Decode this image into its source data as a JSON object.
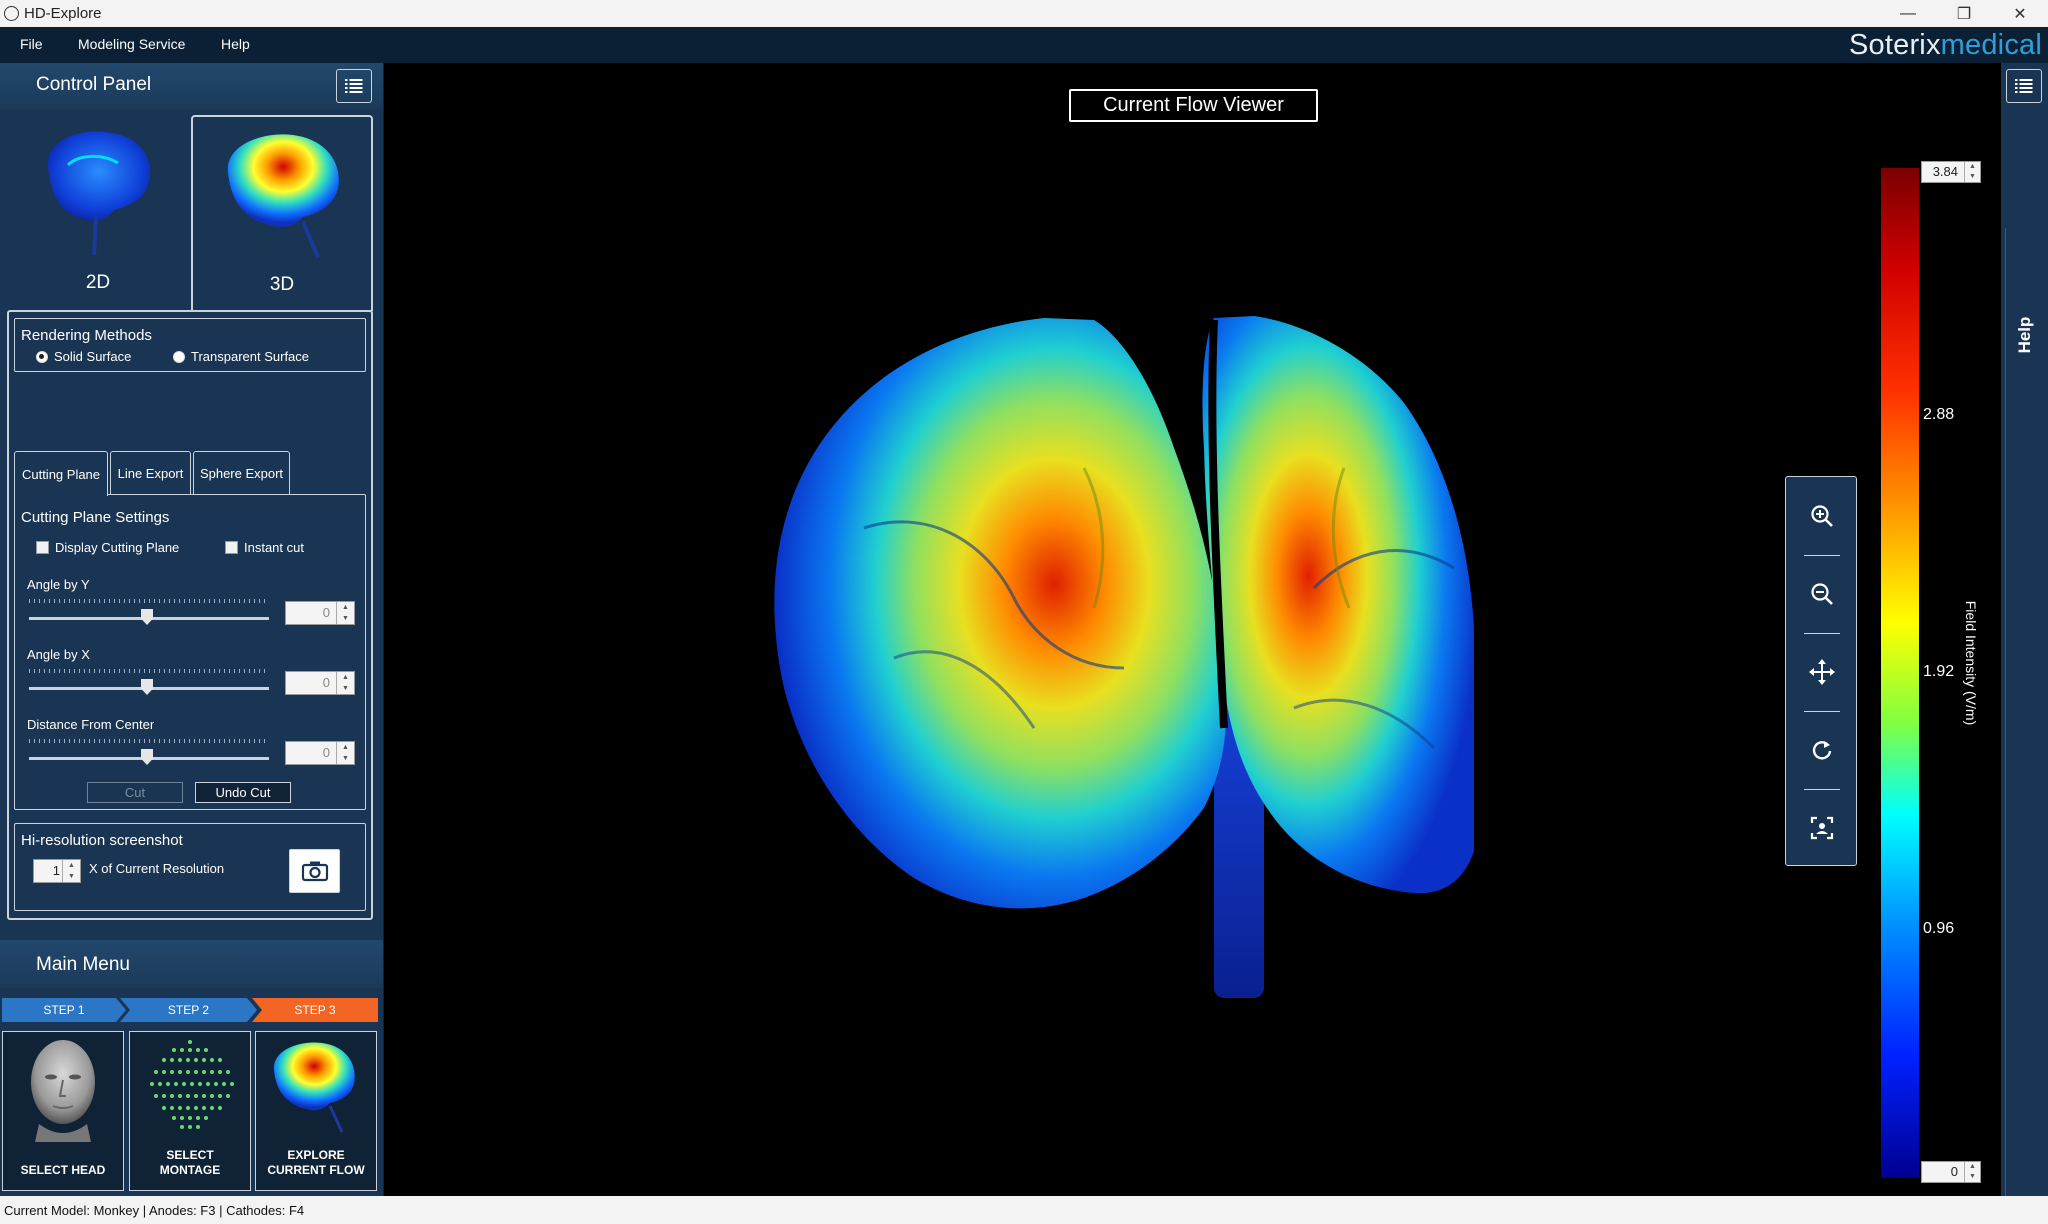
{
  "window": {
    "title": "HD-Explore",
    "minimize": "—",
    "restore": "❐",
    "close": "✕"
  },
  "menu": {
    "file": "File",
    "modeling_service": "Modeling Service",
    "help": "Help",
    "brand_part1": "Soterix",
    "brand_part2": "medical"
  },
  "control_panel": {
    "title": "Control Panel",
    "view_2d": "2D",
    "view_3d": "3D",
    "rendering": {
      "title": "Rendering Methods",
      "solid": "Solid Surface",
      "transparent": "Transparent Surface",
      "selected": "solid"
    },
    "tabs": [
      "Cutting Plane",
      "Line Export",
      "Sphere Export"
    ],
    "active_tab": "Cutting Plane",
    "cutting": {
      "title": "Cutting Plane Settings",
      "display_plane": "Display Cutting Plane",
      "instant_cut": "Instant cut",
      "angle_y_label": "Angle by Y",
      "angle_y_value": "0",
      "angle_x_label": "Angle by X",
      "angle_x_value": "0",
      "distance_label": "Distance From Center",
      "distance_value": "0",
      "cut_label": "Cut",
      "undo_cut_label": "Undo Cut"
    },
    "screenshot": {
      "title": "Hi-resolution screenshot",
      "multiplier": "1",
      "multiplier_label": "X of Current Resolution"
    }
  },
  "main_menu": {
    "title": "Main Menu",
    "steps": [
      "STEP 1",
      "STEP 2",
      "STEP 3"
    ],
    "cards": {
      "head": "SELECT HEAD",
      "montage_1": "SELECT",
      "montage_2": "MONTAGE",
      "explore_1": "EXPLORE",
      "explore_2": "CURRENT FLOW"
    }
  },
  "viewer": {
    "title": "Current Flow Viewer"
  },
  "colorbar": {
    "max": "3.84",
    "min": "0",
    "ticks": [
      "2.88",
      "1.92",
      "0.96"
    ],
    "axis_label": "Field Intensity (V/m)"
  },
  "right_panel": {
    "help": "Help"
  },
  "status": {
    "text": "Current Model: Monkey  |  Anodes: F3  |  Cathodes: F4"
  }
}
